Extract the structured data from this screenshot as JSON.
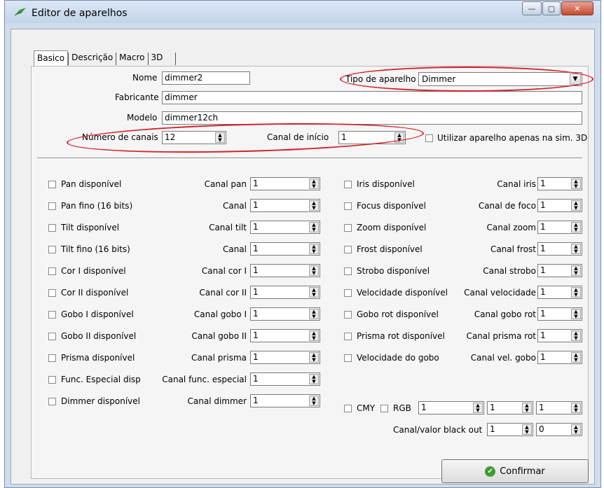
{
  "window": {
    "title": "Editor de aparelhos",
    "controls": {
      "minimize": "—",
      "maximize": "▢",
      "close": "✕"
    }
  },
  "tabs": [
    "Basico",
    "Descrição",
    "Macro",
    "3D"
  ],
  "basic": {
    "name_label": "Nome",
    "name_value": "dimmer2",
    "type_label": "Tipo de aparelho",
    "type_value": "Dimmer",
    "maker_label": "Fabricante",
    "maker_value": "dimmer",
    "model_label": "Modelo",
    "model_value": "dimmer12ch",
    "channels_label": "Número de canais",
    "channels_value": "12",
    "start_label": "Canal de início",
    "start_value": "1",
    "sim3d_label": "Utilizar aparelho apenas na sim. 3D"
  },
  "left_rows": [
    {
      "check": "Pan disponível",
      "chan": "Canal pan",
      "value": "1"
    },
    {
      "check": "Pan fino (16 bits)",
      "chan": "Canal",
      "value": "1"
    },
    {
      "check": "Tilt disponível",
      "chan": "Canal tilt",
      "value": "1"
    },
    {
      "check": "Tilt fino (16 bits)",
      "chan": "Canal",
      "value": "1"
    },
    {
      "check": "Cor I disponível",
      "chan": "Canal cor I",
      "value": "1"
    },
    {
      "check": "Cor II disponível",
      "chan": "Canal cor II",
      "value": "1"
    },
    {
      "check": "Gobo I disponível",
      "chan": "Canal gobo I",
      "value": "1"
    },
    {
      "check": "Gobo II disponível",
      "chan": "Canal gobo II",
      "value": "1"
    },
    {
      "check": "Prisma disponível",
      "chan": "Canal prisma",
      "value": "1"
    },
    {
      "check": "Func. Especial disp",
      "chan": "Canal func. especial",
      "value": "1"
    },
    {
      "check": "Dimmer disponível",
      "chan": "Canal dimmer",
      "value": "1"
    }
  ],
  "right_rows": [
    {
      "check": "Iris disponível",
      "chan": "Canal iris",
      "value": "1"
    },
    {
      "check": "Focus disponível",
      "chan": "Canal de foco",
      "value": "1"
    },
    {
      "check": "Zoom disponível",
      "chan": "Canal zoom",
      "value": "1"
    },
    {
      "check": "Frost disponível",
      "chan": "Canal frost",
      "value": "1"
    },
    {
      "check": "Strobo disponível",
      "chan": "Canal strobo",
      "value": "1"
    },
    {
      "check": "Velocidade disponível",
      "chan": "Canal velocidade",
      "value": "1"
    },
    {
      "check": "Gobo rot disponível",
      "chan": "Canal gobo rot",
      "value": "1"
    },
    {
      "check": "Prisma rot disponível",
      "chan": "Canal prisma rot",
      "value": "1"
    },
    {
      "check": "Velocidade do gobo",
      "chan": "Canal vel. gobo",
      "value": "1"
    }
  ],
  "cmy_row": {
    "cmy": "CMY",
    "rgb": "RGB",
    "values": [
      "1",
      "1",
      "1"
    ]
  },
  "blackout": {
    "label": "Canal/valor black out",
    "channel": "1",
    "value": "0"
  },
  "confirm_label": "Confirmar",
  "colors": {
    "highlight_oval": "#d2222a",
    "confirm_icon": "#3f9b2e"
  }
}
